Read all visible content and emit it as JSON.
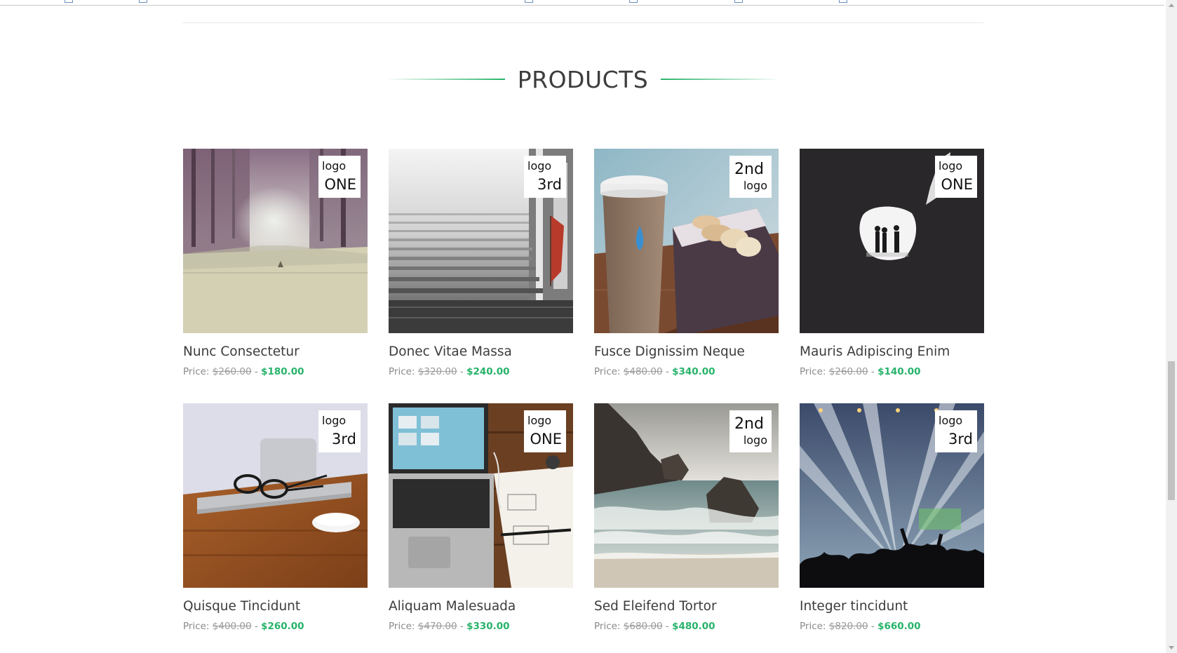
{
  "section": {
    "title": "PRODUCTS"
  },
  "colors": {
    "accent": "#27b36a",
    "text": "#3c3c3c",
    "old_price": "#9a9a9a"
  },
  "products": [
    {
      "name": "Nunc Consectetur",
      "price_label": "Price:",
      "old_price": "$260.00",
      "separator": " - ",
      "new_price": "$180.00",
      "badge": {
        "top": "logo",
        "bottom": "ONE"
      },
      "image": "misty-forest-road"
    },
    {
      "name": "Donec Vitae Massa",
      "price_label": "Price:",
      "old_price": "$320.00",
      "separator": " - ",
      "new_price": "$240.00",
      "badge": {
        "top": "logo",
        "bottom": "3rd"
      },
      "image": "foggy-stone-stairs"
    },
    {
      "name": "Fusce Dignissim Neque",
      "price_label": "Price:",
      "old_price": "$480.00",
      "separator": " - ",
      "new_price": "$340.00",
      "badge": {
        "top": "2nd",
        "bottom": "logo"
      },
      "image": "coffee-cup-and-macarons"
    },
    {
      "name": "Mauris Adipiscing Enim",
      "price_label": "Price:",
      "old_price": "$260.00",
      "separator": " - ",
      "new_price": "$140.00",
      "badge": {
        "top": "logo",
        "bottom": "ONE"
      },
      "image": "cave-silhouettes"
    },
    {
      "name": "Quisque Tincidunt",
      "price_label": "Price:",
      "old_price": "$400.00",
      "separator": " - ",
      "new_price": "$260.00",
      "badge": {
        "top": "logo",
        "bottom": "3rd"
      },
      "image": "glasses-on-laptop-desk"
    },
    {
      "name": "Aliquam Malesuada",
      "price_label": "Price:",
      "old_price": "$470.00",
      "separator": " - ",
      "new_price": "$330.00",
      "badge": {
        "top": "logo",
        "bottom": "ONE"
      },
      "image": "laptop-and-notebook"
    },
    {
      "name": "Sed Eleifend Tortor",
      "price_label": "Price:",
      "old_price": "$680.00",
      "separator": " - ",
      "new_price": "$480.00",
      "badge": {
        "top": "2nd",
        "bottom": "logo"
      },
      "image": "rocky-sea-coast"
    },
    {
      "name": "Integer tincidunt",
      "price_label": "Price:",
      "old_price": "$820.00",
      "separator": " - ",
      "new_price": "$660.00",
      "badge": {
        "top": "logo",
        "bottom": "3rd"
      },
      "image": "concert-light-beams"
    }
  ]
}
